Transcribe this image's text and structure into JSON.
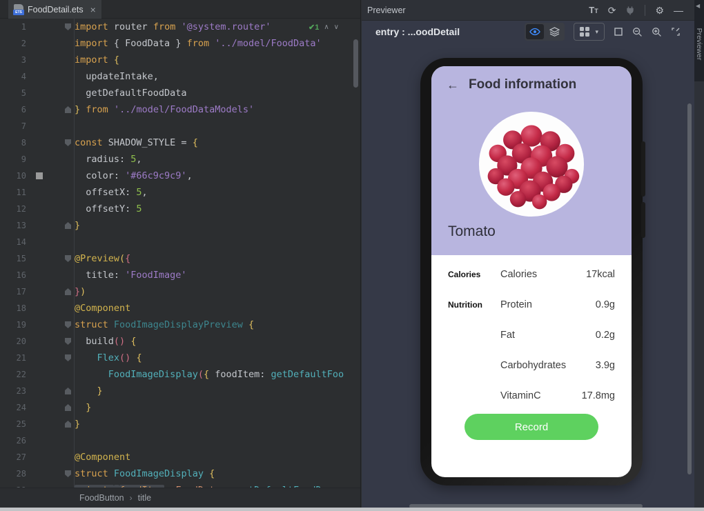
{
  "colors": {
    "accent_blue": "#3f8cff",
    "lavender": "#b8b5df",
    "record_green": "#5ed15f",
    "swatch_value": "#66c9c9c9"
  },
  "glyphs": {
    "close": "×",
    "check": "✔",
    "up": "∧",
    "down": "∨",
    "sep": "›",
    "refresh": "⟳",
    "gear": "⚙",
    "minus": "—",
    "chevron_down": "▾",
    "frame": "□",
    "back": "←"
  },
  "editor": {
    "tab": {
      "title": "FoodDetail.ets"
    },
    "inspection": {
      "count": "1"
    },
    "breadcrumb": {
      "items": [
        "FoodButton",
        "title"
      ]
    },
    "lines": [
      {
        "n": 1,
        "fold": "open",
        "widget": true,
        "seg": [
          [
            "k",
            "import"
          ],
          [
            "p",
            " router "
          ],
          [
            "k",
            "from"
          ],
          [
            "p",
            " "
          ],
          [
            "s",
            "'@system.router'"
          ]
        ]
      },
      {
        "n": 2,
        "seg": [
          [
            "k",
            "import"
          ],
          [
            "p",
            " { FoodData } "
          ],
          [
            "k",
            "from"
          ],
          [
            "p",
            " "
          ],
          [
            "s",
            "'../model/FoodData'"
          ]
        ]
      },
      {
        "n": 3,
        "seg": [
          [
            "k",
            "import"
          ],
          [
            "p",
            " "
          ],
          [
            "y",
            "{"
          ]
        ]
      },
      {
        "n": 4,
        "seg": [
          [
            "p",
            "  updateIntake,"
          ]
        ]
      },
      {
        "n": 5,
        "seg": [
          [
            "p",
            "  getDefaultFoodData"
          ]
        ]
      },
      {
        "n": 6,
        "fold": "close",
        "seg": [
          [
            "y",
            "}"
          ],
          [
            "p",
            " "
          ],
          [
            "k",
            "from"
          ],
          [
            "p",
            " "
          ],
          [
            "s",
            "'../model/FoodDataModels'"
          ]
        ]
      },
      {
        "n": 7,
        "seg": []
      },
      {
        "n": 8,
        "fold": "open",
        "seg": [
          [
            "k",
            "const"
          ],
          [
            "p",
            " SHADOW_STYLE = "
          ],
          [
            "y",
            "{"
          ]
        ]
      },
      {
        "n": 9,
        "seg": [
          [
            "p",
            "  radius: "
          ],
          [
            "n",
            "5"
          ],
          [
            "p",
            ","
          ]
        ]
      },
      {
        "n": 10,
        "swatch": true,
        "seg": [
          [
            "p",
            "  color: "
          ],
          [
            "s",
            "'#66c9c9c9'"
          ],
          [
            "p",
            ","
          ]
        ]
      },
      {
        "n": 11,
        "seg": [
          [
            "p",
            "  offsetX: "
          ],
          [
            "n",
            "5"
          ],
          [
            "p",
            ","
          ]
        ]
      },
      {
        "n": 12,
        "seg": [
          [
            "p",
            "  offsetY: "
          ],
          [
            "n",
            "5"
          ]
        ]
      },
      {
        "n": 13,
        "fold": "close",
        "seg": [
          [
            "y",
            "}"
          ]
        ]
      },
      {
        "n": 14,
        "seg": []
      },
      {
        "n": 15,
        "fold": "open",
        "seg": [
          [
            "a",
            "@Preview"
          ],
          [
            "y",
            "("
          ],
          [
            "pk",
            "{"
          ]
        ]
      },
      {
        "n": 16,
        "seg": [
          [
            "p",
            "  title: "
          ],
          [
            "s",
            "'FoodImage'"
          ]
        ]
      },
      {
        "n": 17,
        "fold": "close",
        "seg": [
          [
            "pk",
            "}"
          ],
          [
            "y",
            ")"
          ]
        ]
      },
      {
        "n": 18,
        "seg": [
          [
            "a",
            "@Component"
          ]
        ]
      },
      {
        "n": 19,
        "fold": "open",
        "seg": [
          [
            "k",
            "struct"
          ],
          [
            "td",
            " FoodImageDisplayPreview "
          ],
          [
            "y",
            "{"
          ]
        ]
      },
      {
        "n": 20,
        "fold": "open",
        "seg": [
          [
            "p",
            "  build"
          ],
          [
            "pk",
            "()"
          ],
          [
            "p",
            " "
          ],
          [
            "y",
            "{"
          ]
        ]
      },
      {
        "n": 21,
        "fold": "open",
        "seg": [
          [
            "p",
            "    "
          ],
          [
            "t",
            "Flex"
          ],
          [
            "pk",
            "()"
          ],
          [
            "p",
            " "
          ],
          [
            "y",
            "{"
          ]
        ]
      },
      {
        "n": 22,
        "seg": [
          [
            "p",
            "      "
          ],
          [
            "t",
            "FoodImageDisplay"
          ],
          [
            "pk",
            "("
          ],
          [
            "y",
            "{"
          ],
          [
            "p",
            " foodItem: "
          ],
          [
            "t",
            "getDefaultFoo"
          ]
        ]
      },
      {
        "n": 23,
        "fold": "close",
        "seg": [
          [
            "p",
            "    "
          ],
          [
            "y",
            "}"
          ]
        ]
      },
      {
        "n": 24,
        "fold": "close",
        "seg": [
          [
            "p",
            "  "
          ],
          [
            "y",
            "}"
          ]
        ]
      },
      {
        "n": 25,
        "fold": "close",
        "seg": [
          [
            "y",
            "}"
          ]
        ]
      },
      {
        "n": 26,
        "seg": []
      },
      {
        "n": 27,
        "seg": [
          [
            "a",
            "@Component"
          ]
        ]
      },
      {
        "n": 28,
        "fold": "open",
        "seg": [
          [
            "k",
            "struct"
          ],
          [
            "t",
            " FoodImageDisplay "
          ],
          [
            "y",
            "{"
          ]
        ]
      },
      {
        "n": 29,
        "seg": [
          [
            "k",
            "private",
            1
          ],
          [
            "p",
            " ",
            1
          ],
          [
            "f",
            "foodItem",
            1
          ],
          [
            "p",
            ": "
          ],
          [
            "o",
            "FoodData"
          ],
          [
            "p",
            " = "
          ],
          [
            "t",
            "getDefaultFoodDa"
          ]
        ]
      }
    ]
  },
  "previewer": {
    "title": "Previewer",
    "target": "entry : ...oodDetail",
    "side_tab_label": "Previewer",
    "top_icons": [
      "font-settings",
      "refresh",
      "plugin",
      "settings",
      "minimize"
    ],
    "view_icons": [
      "inspect-eye",
      "layers",
      "component-grid",
      "frame",
      "zoom-out",
      "zoom-in",
      "fit-screen"
    ]
  },
  "phone": {
    "header": {
      "title": "Food information"
    },
    "food_name": "Tomato",
    "rows": [
      {
        "category": "Calories",
        "name": "Calories",
        "value": "17kcal"
      },
      {
        "category": "Nutrition",
        "name": "Protein",
        "value": "0.9g"
      },
      {
        "category": "",
        "name": "Fat",
        "value": "0.2g"
      },
      {
        "category": "",
        "name": "Carbohydrates",
        "value": "3.9g"
      },
      {
        "category": "",
        "name": "VitaminC",
        "value": "17.8mg"
      }
    ],
    "button": {
      "label": "Record"
    }
  }
}
